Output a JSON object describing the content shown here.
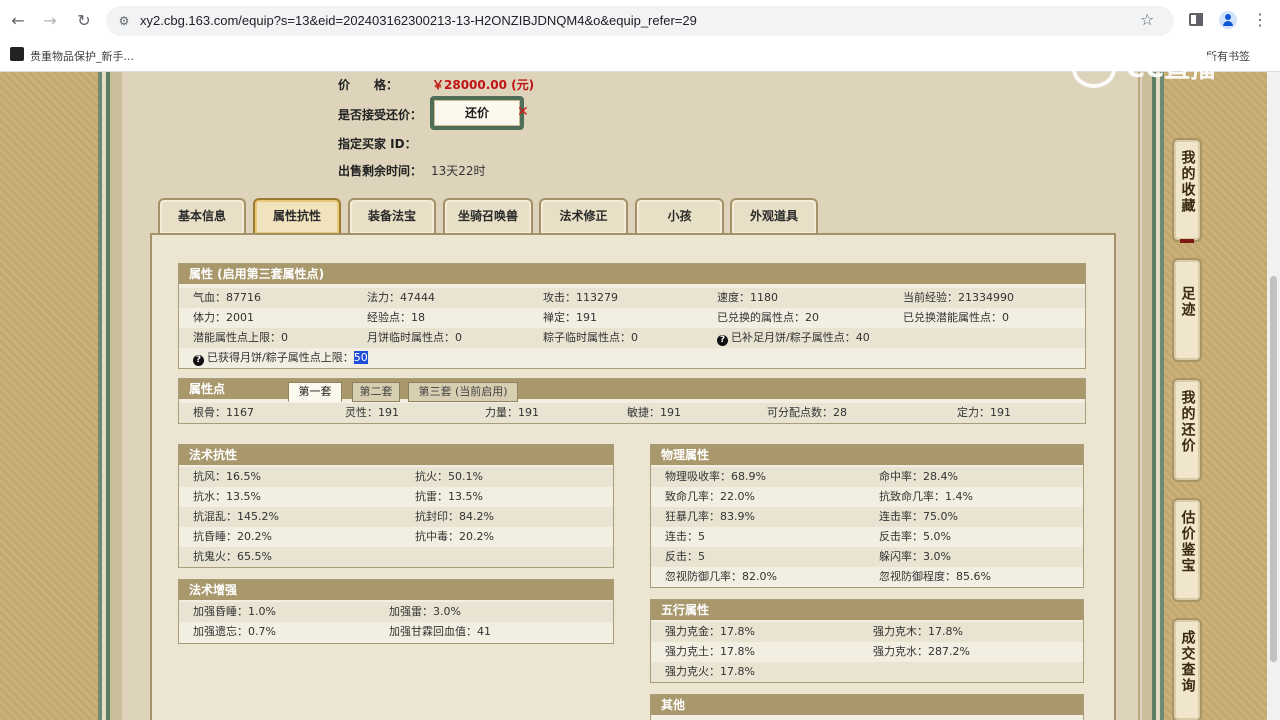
{
  "browser": {
    "url": "xy2.cbg.163.com/equip?s=13&eid=202403162300213-13-H2ONZIBJDNQM4&o&equip_refer=29",
    "bookmark": "贵重物品保护_新手...",
    "all_bookmarks": "所有书签",
    "back_icon": "arrow-left-icon",
    "forward_icon": "arrow-right-icon",
    "reload_icon": "reload-icon"
  },
  "watermark": "CC直播",
  "trade": {
    "price_label": "价　　格：",
    "price": "￥28000.00 (元)",
    "counter_label": "是否接受还价：",
    "counter_button": "还价",
    "buyer_label": "指定买家 ID：",
    "time_label": "出售剩余时间：",
    "time_value": "13天22时"
  },
  "tabs": [
    "基本信息",
    "属性抗性",
    "装备法宝",
    "坐骑召唤兽",
    "法术修正",
    "小孩",
    "外观道具"
  ],
  "side_tabs": [
    "我的收藏",
    "足迹",
    "我的还价",
    "估价鉴宝",
    "成交查询"
  ],
  "attributes": {
    "title": "属性 (启用第三套属性点)",
    "rows": [
      [
        "气血：87716",
        "法力：47444",
        "攻击：113279",
        "速度：1180",
        "当前经验：21334990"
      ],
      [
        "体力：2001",
        "经验点：18",
        "禅定：191",
        "已兑换的属性点：20",
        "已兑换潜能属性点：0"
      ],
      [
        "潜能属性点上限：0",
        "月饼临时属性点：0",
        "粽子临时属性点：0",
        "已补足月饼/粽子属性点：40",
        ""
      ]
    ],
    "extra_label": "已获得月饼/粽子属性点上限：",
    "extra_value": "50"
  },
  "points": {
    "title": "属性点",
    "subtabs": [
      "第一套",
      "第二套",
      "第三套 (当前启用)"
    ],
    "values": [
      "根骨：1167",
      "灵性：191",
      "力量：191",
      "敏捷：191",
      "可分配点数：28",
      "定力：191"
    ]
  },
  "resist": {
    "title": "法术抗性",
    "rows": [
      [
        "抗风：16.5%",
        "抗火：50.1%"
      ],
      [
        "抗水：13.5%",
        "抗雷：13.5%"
      ],
      [
        "抗混乱：145.2%",
        "抗封印：84.2%"
      ],
      [
        "抗昏睡：20.2%",
        "抗中毒：20.2%"
      ],
      [
        "抗鬼火：65.5%",
        ""
      ]
    ]
  },
  "enhance": {
    "title": "法术增强",
    "rows": [
      [
        "加强昏睡：1.0%",
        "加强雷：3.0%"
      ],
      [
        "加强遗忘：0.7%",
        "加强甘霖回血值：41"
      ]
    ]
  },
  "physical": {
    "title": "物理属性",
    "rows": [
      [
        "物理吸收率：68.9%",
        "命中率：28.4%"
      ],
      [
        "致命几率：22.0%",
        "抗致命几率：1.4%"
      ],
      [
        "狂暴几率：83.9%",
        "连击率：75.0%"
      ],
      [
        "连击：5",
        "反击率：5.0%"
      ],
      [
        "反击：5",
        "躲闪率：3.0%"
      ],
      [
        "忽视防御几率：82.0%",
        "忽视防御程度：85.6%"
      ]
    ]
  },
  "wuxing": {
    "title": "五行属性",
    "rows": [
      [
        "强力克金：17.8%",
        "强力克木：17.8%"
      ],
      [
        "强力克土：17.8%",
        "强力克水：287.2%"
      ],
      [
        "强力克火：17.8%",
        ""
      ]
    ]
  },
  "other": {
    "title": "其他"
  }
}
